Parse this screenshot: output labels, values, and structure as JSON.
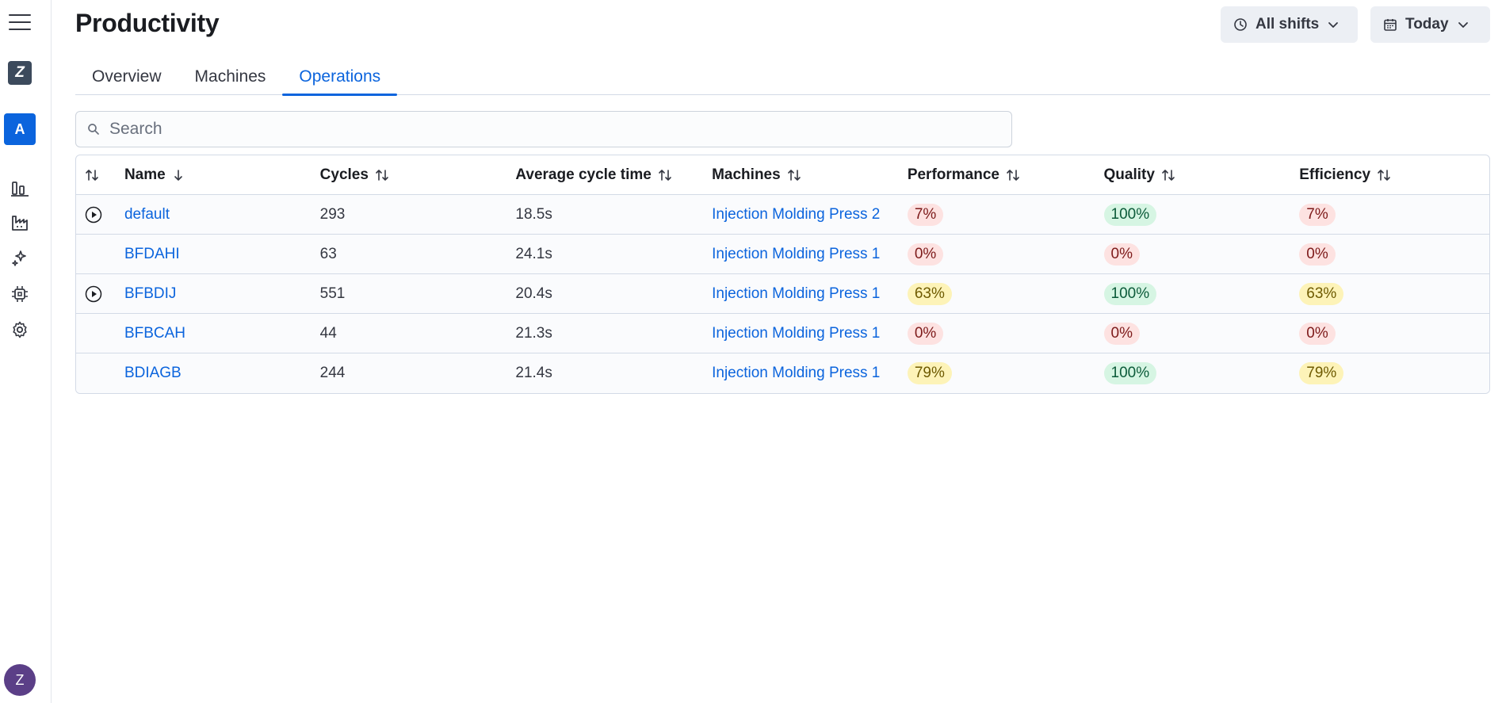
{
  "page": {
    "title": "Productivity"
  },
  "sidebar": {
    "logo": "Z",
    "space_initial": "A",
    "user_initial": "Z",
    "nav_icons": [
      "bar-chart-icon",
      "factory-icon",
      "sparkles-icon",
      "chip-icon",
      "gear-icon"
    ]
  },
  "header": {
    "shifts_label": "All shifts",
    "date_label": "Today"
  },
  "tabs": [
    {
      "label": "Overview",
      "active": false
    },
    {
      "label": "Machines",
      "active": false
    },
    {
      "label": "Operations",
      "active": true
    }
  ],
  "search": {
    "placeholder": "Search",
    "value": ""
  },
  "table": {
    "columns": [
      "Name",
      "Cycles",
      "Average cycle time",
      "Machines",
      "Performance",
      "Quality",
      "Efficiency"
    ],
    "rows": [
      {
        "running": true,
        "name": "default",
        "cycles": "293",
        "avg_cycle_time": "18.5s",
        "machine": "Injection Molding Press 2",
        "performance": "7%",
        "performance_level": "red",
        "quality": "100%",
        "quality_level": "green",
        "efficiency": "7%",
        "efficiency_level": "red"
      },
      {
        "running": false,
        "name": "BFDAHI",
        "cycles": "63",
        "avg_cycle_time": "24.1s",
        "machine": "Injection Molding Press 1",
        "performance": "0%",
        "performance_level": "red",
        "quality": "0%",
        "quality_level": "red",
        "efficiency": "0%",
        "efficiency_level": "red"
      },
      {
        "running": true,
        "name": "BFBDIJ",
        "cycles": "551",
        "avg_cycle_time": "20.4s",
        "machine": "Injection Molding Press 1",
        "performance": "63%",
        "performance_level": "yellow",
        "quality": "100%",
        "quality_level": "green",
        "efficiency": "63%",
        "efficiency_level": "yellow"
      },
      {
        "running": false,
        "name": "BFBCAH",
        "cycles": "44",
        "avg_cycle_time": "21.3s",
        "machine": "Injection Molding Press 1",
        "performance": "0%",
        "performance_level": "red",
        "quality": "0%",
        "quality_level": "red",
        "efficiency": "0%",
        "efficiency_level": "red"
      },
      {
        "running": false,
        "name": "BDIAGB",
        "cycles": "244",
        "avg_cycle_time": "21.4s",
        "machine": "Injection Molding Press 1",
        "performance": "79%",
        "performance_level": "yellow",
        "quality": "100%",
        "quality_level": "green",
        "efficiency": "79%",
        "efficiency_level": "yellow"
      }
    ]
  },
  "colors": {
    "accent": "#0b64dd",
    "badge_red_bg": "#fde2e1",
    "badge_green_bg": "#d6f5e3",
    "badge_yellow_bg": "#fdf3b8",
    "avatar": "#5b3f87"
  }
}
